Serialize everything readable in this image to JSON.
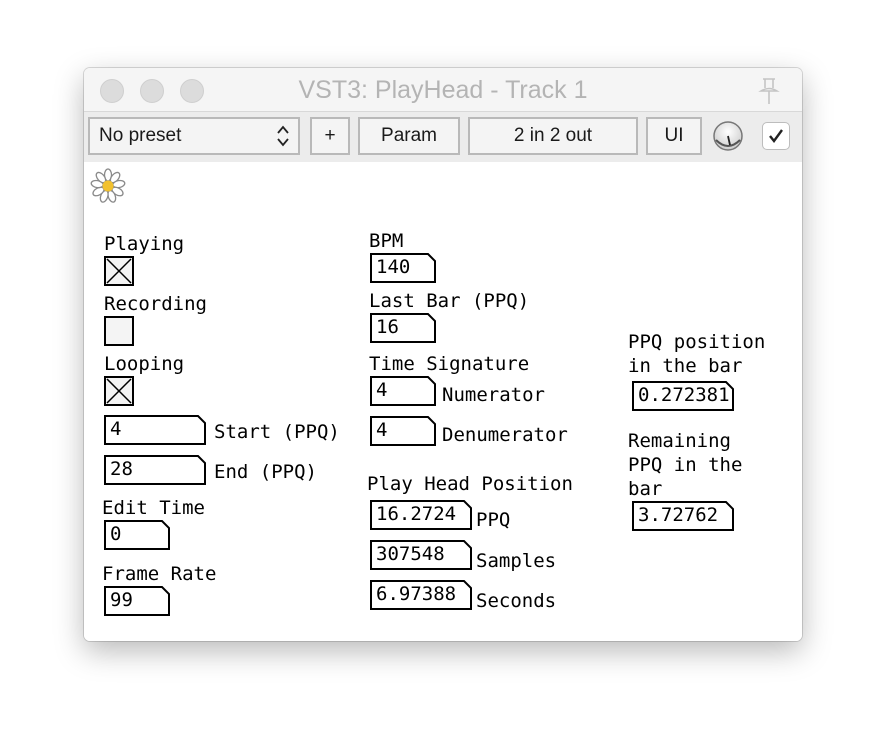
{
  "window": {
    "title": "VST3: PlayHead - Track 1"
  },
  "toolbar": {
    "preset": "No preset",
    "add_label": "+",
    "param_label": "Param",
    "io_label": "2 in 2 out",
    "ui_label": "UI",
    "enabled": true
  },
  "left": {
    "playing_label": "Playing",
    "playing": true,
    "recording_label": "Recording",
    "recording": false,
    "looping_label": "Looping",
    "looping": true,
    "loop_start": "4",
    "loop_start_label": "Start (PPQ)",
    "loop_end": "28",
    "loop_end_label": "End (PPQ)",
    "edit_time_label": "Edit Time",
    "edit_time": "0",
    "frame_rate_label": "Frame Rate",
    "frame_rate": "99"
  },
  "middle": {
    "bpm_label": "BPM",
    "bpm": "140",
    "last_bar_label": "Last Bar (PPQ)",
    "last_bar": "16",
    "time_sig_label": "Time Signature",
    "numerator": "4",
    "numerator_label": "Numerator",
    "denominator": "4",
    "denominator_label": "Denumerator",
    "playhead_label": "Play Head Position",
    "ppq": "16.2724",
    "ppq_label": "PPQ",
    "samples": "307548",
    "samples_label": "Samples",
    "seconds": "6.97388",
    "seconds_label": "Seconds"
  },
  "right": {
    "ppq_in_bar_label_1": "PPQ position",
    "ppq_in_bar_label_2": "in the bar",
    "ppq_in_bar": "0.272381",
    "remaining_label_1": "Remaining",
    "remaining_label_2": "PPQ in the",
    "remaining_label_3": "bar",
    "remaining": "3.72762"
  },
  "colors": {
    "flower_center": "#f2c12e",
    "title_text": "#b4b4b4",
    "toolbar_bg": "#ececec"
  }
}
